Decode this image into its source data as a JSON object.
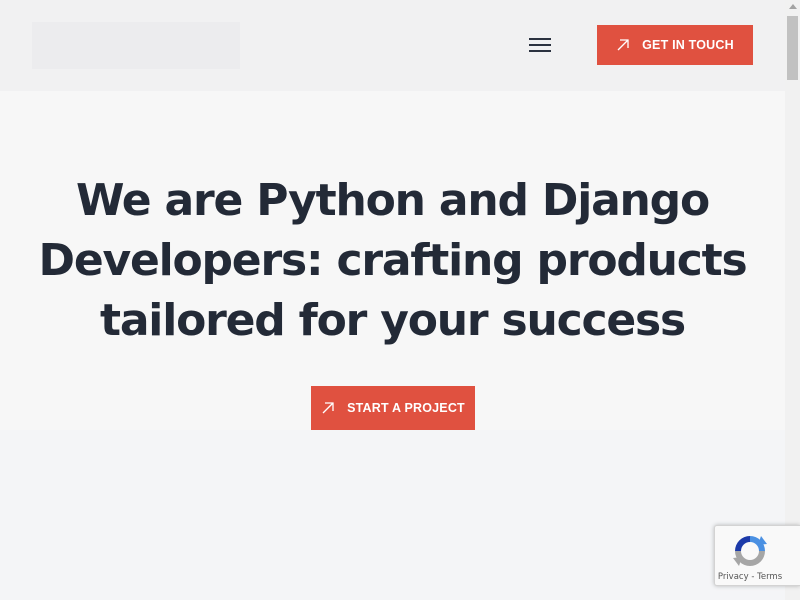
{
  "header": {
    "menu_icon": "hamburger-menu-icon",
    "cta_label": "GET IN TOUCH",
    "cta_icon": "arrow-up-right-icon"
  },
  "hero": {
    "title_lines": [
      "We are Python and Django",
      "Developers: crafting products",
      "tailored for your success"
    ],
    "cta_label": "START A PROJECT",
    "cta_icon": "arrow-up-right-icon"
  },
  "recaptcha": {
    "privacy_label": "Privacy",
    "separator": " - ",
    "terms_label": "Terms",
    "logo_icon": "recaptcha-logo-icon"
  },
  "colors": {
    "accent": "#e05140",
    "text": "#232a37",
    "header_bg": "#f1f1f2",
    "hero_bg": "#f7f7f7",
    "page_bg": "#f4f5f7"
  }
}
